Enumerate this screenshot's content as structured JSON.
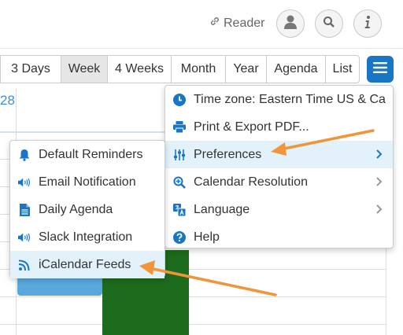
{
  "header": {
    "reader_label": "Reader",
    "icons": [
      "link-icon",
      "user-icon",
      "search-icon",
      "info-icon"
    ]
  },
  "view_buttons": [
    {
      "label": "3 Days",
      "active": false
    },
    {
      "label": "Week",
      "active": true
    },
    {
      "label": "4 Weeks",
      "active": false
    },
    {
      "label": "Month",
      "active": false
    },
    {
      "label": "Year",
      "active": false
    },
    {
      "label": "Agenda",
      "active": false
    },
    {
      "label": "List",
      "active": false
    }
  ],
  "calendar": {
    "visible_date": "28"
  },
  "main_menu": {
    "items": [
      {
        "label": "Time zone: Eastern Time US & Ca",
        "icon": "clock-icon",
        "submenu": false
      },
      {
        "label": "Print & Export PDF...",
        "icon": "printer-icon",
        "submenu": false
      },
      {
        "label": "Preferences",
        "icon": "sliders-icon",
        "submenu": true,
        "highlighted": true
      },
      {
        "label": "Calendar Resolution",
        "icon": "zoom-in-icon",
        "submenu": true
      },
      {
        "label": "Language",
        "icon": "translate-icon",
        "submenu": true
      },
      {
        "label": "Help",
        "icon": "help-icon",
        "submenu": false
      }
    ]
  },
  "preferences_submenu": {
    "items": [
      {
        "label": "Default Reminders",
        "icon": "bell-icon"
      },
      {
        "label": "Email Notification",
        "icon": "volume-icon"
      },
      {
        "label": "Daily Agenda",
        "icon": "document-icon"
      },
      {
        "label": "Slack Integration",
        "icon": "volume-icon"
      },
      {
        "label": "iCalendar Feeds",
        "icon": "rss-icon",
        "highlighted": true
      }
    ]
  },
  "colors": {
    "accent": "#1976c5",
    "highlight": "#e3f2fa",
    "arrow": "#f0953a",
    "event_blue": "#5aa7dc",
    "event_green": "#1d6b1d"
  }
}
